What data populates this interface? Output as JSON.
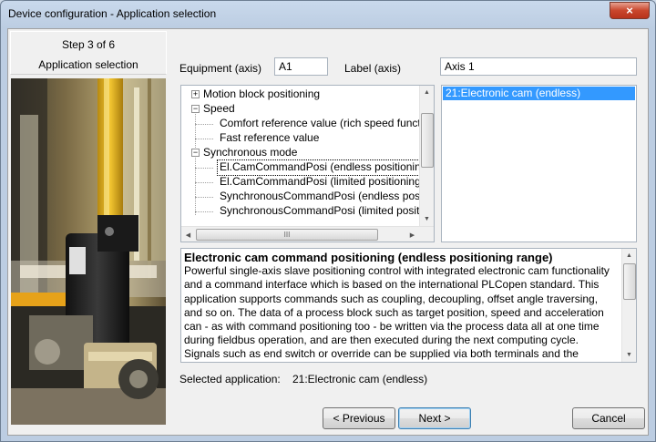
{
  "window": {
    "title": "Device configuration - Application selection",
    "close_glyph": "×"
  },
  "step_panel": {
    "step": "Step 3 of 6",
    "name": "Application selection"
  },
  "equipment": {
    "label": "Equipment (axis)",
    "value": "A1"
  },
  "axis_label": {
    "label": "Label (axis)",
    "value": "Axis 1"
  },
  "tree": {
    "items": [
      {
        "label": "Motion block positioning"
      },
      {
        "label": "Speed"
      },
      {
        "label": "Comfort reference value (rich speed functionali"
      },
      {
        "label": "Fast reference value"
      },
      {
        "label": "Synchronous mode"
      },
      {
        "label": "El.CamCommandPosi (endless positioning range)"
      },
      {
        "label": "El.CamCommandPosi (limited positioning range)"
      },
      {
        "label": "SynchronousCommandPosi (endless positioning"
      },
      {
        "label": "SynchronousCommandPosi (limited positioning"
      }
    ],
    "hscroll_grip": "III"
  },
  "application_list": {
    "items": [
      "21:Electronic cam (endless)"
    ]
  },
  "description": {
    "title": "Electronic cam command positioning (endless positioning range)",
    "lines": [
      "Powerful single-axis slave positioning control with integrated electronic cam functionality",
      "and a command interface which is based on the international PLCopen standard. This",
      "application supports commands such as coupling, decoupling, offset angle traversing,",
      "and so on. The data of a process block such as target position, speed and acceleration",
      "can - as with command positioning too - be written via the process data all at one time",
      "during fieldbus operation, and are then executed during the next computing cycle.",
      "Signals such as end switch or override can be supplied via both terminals and the"
    ]
  },
  "selected_application": {
    "label": "Selected application:",
    "value": "21:Electronic cam (endless)"
  },
  "buttons": {
    "previous": "< Previous",
    "next": "Next >",
    "cancel": "Cancel"
  }
}
